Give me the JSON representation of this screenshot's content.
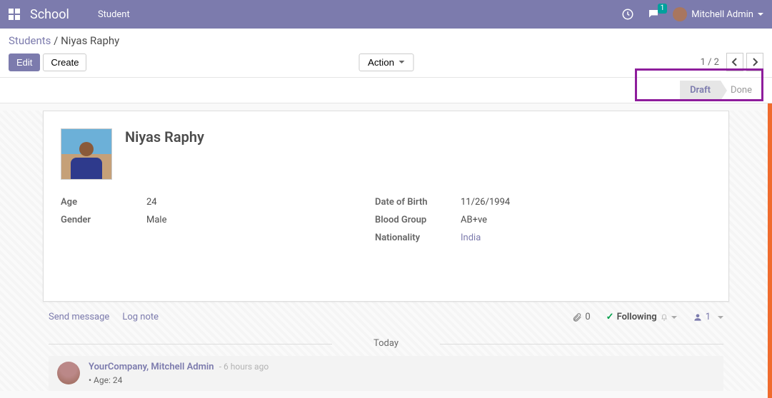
{
  "navbar": {
    "brand": "School",
    "menu_item": "Student",
    "messages_badge": "1",
    "user_name": "Mitchell Admin"
  },
  "breadcrumb": {
    "parent": "Students",
    "current": "Niyas Raphy"
  },
  "buttons": {
    "edit": "Edit",
    "create": "Create",
    "action": "Action"
  },
  "pager": {
    "text": "1 / 2"
  },
  "status": {
    "draft": "Draft",
    "done": "Done"
  },
  "record": {
    "title": "Niyas Raphy",
    "fields_left": {
      "age_label": "Age",
      "age_value": "24",
      "gender_label": "Gender",
      "gender_value": "Male"
    },
    "fields_right": {
      "dob_label": "Date of Birth",
      "dob_value": "11/26/1994",
      "blood_label": "Blood Group",
      "blood_value": "AB+ve",
      "nationality_label": "Nationality",
      "nationality_value": "India"
    }
  },
  "chatter": {
    "send_message": "Send message",
    "log_note": "Log note",
    "attachments_count": "0",
    "following_label": "Following",
    "followers_count": "1",
    "today_label": "Today",
    "msg_author": "YourCompany, Mitchell Admin",
    "msg_time": "- 6 hours ago",
    "msg_line": "Age: 24"
  }
}
